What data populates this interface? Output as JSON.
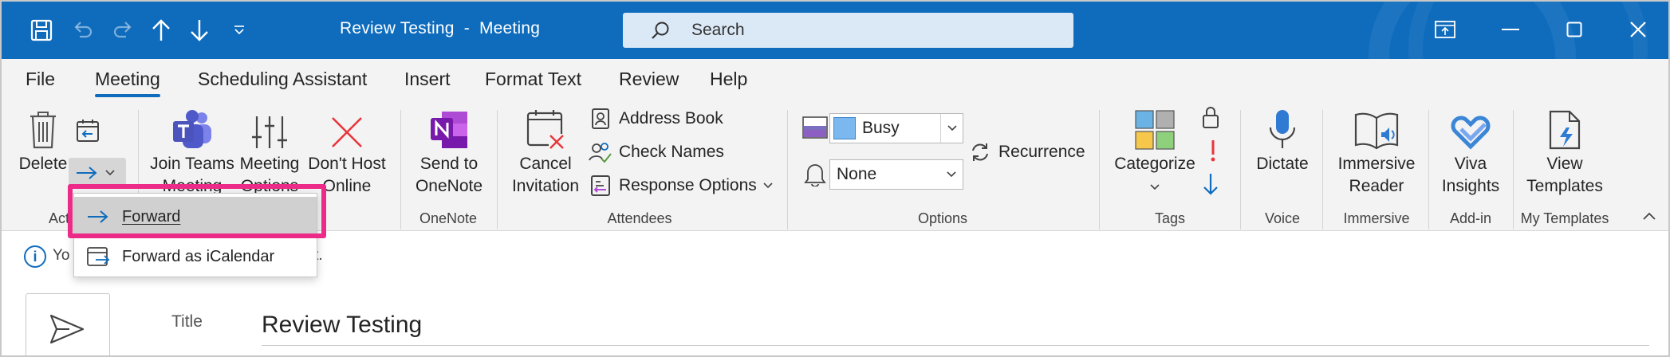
{
  "window": {
    "title": "Review Testing  -  Meeting"
  },
  "search": {
    "placeholder": "Search"
  },
  "tabs": [
    {
      "label": "File"
    },
    {
      "label": "Meeting"
    },
    {
      "label": "Scheduling Assistant"
    },
    {
      "label": "Insert"
    },
    {
      "label": "Format Text"
    },
    {
      "label": "Review"
    },
    {
      "label": "Help"
    }
  ],
  "ribbon": {
    "delete_label": "Delete",
    "teams_label_1": "Join Teams",
    "teams_label_2": "Meeting",
    "meeting_options_1": "Meeting",
    "meeting_options_2": "Options",
    "dont_host_1": "Don't Host",
    "dont_host_2": "Online",
    "send_onenote_1": "Send to",
    "send_onenote_2": "OneNote",
    "cancel_invitation_1": "Cancel",
    "cancel_invitation_2": "Invitation",
    "address_book": "Address Book",
    "check_names": "Check Names",
    "response_options": "Response Options",
    "show_as_value": "Busy",
    "reminder_value": "None",
    "recurrence": "Recurrence",
    "categorize": "Categorize",
    "dictate": "Dictate",
    "immersive_1": "Immersive",
    "immersive_2": "Reader",
    "viva_1": "Viva",
    "viva_2": "Insights",
    "view_templates_1": "View",
    "view_templates_2": "Templates",
    "groups": {
      "actions": "Act",
      "onenote": "OneNote",
      "attendees": "Attendees",
      "options": "Options",
      "tags": "Tags",
      "voice": "Voice",
      "immersive": "Immersive",
      "addin": "Add-in",
      "mytemplates": "My Templates"
    }
  },
  "forward_menu": {
    "forward": "Forward",
    "forward_ical": "Forward as iCalendar"
  },
  "infobar": {
    "text_left": "Yo",
    "text_right": "yet."
  },
  "form": {
    "title_label": "Title",
    "title_value": "Review Testing"
  }
}
